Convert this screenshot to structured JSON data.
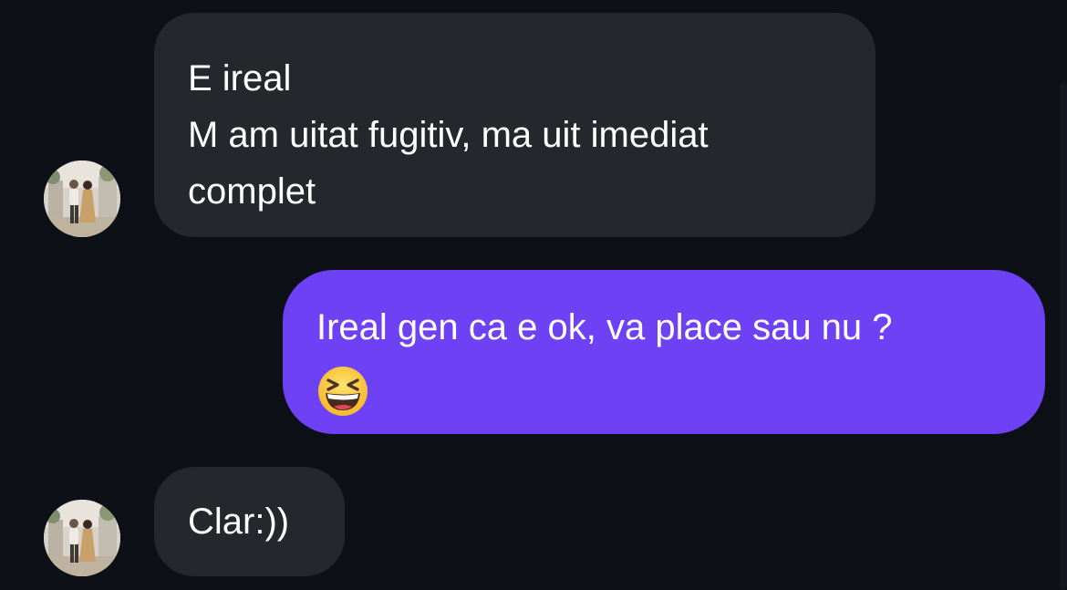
{
  "messages": [
    {
      "direction": "incoming",
      "lines": [
        "E ireal",
        "M am uitat fugitiv, ma uit imediat",
        "complet"
      ],
      "has_avatar": true
    },
    {
      "direction": "outgoing",
      "lines": [
        "Ireal gen ca e ok, va place sau nu ?"
      ],
      "emoji": "grinning-squinting-face"
    },
    {
      "direction": "incoming",
      "lines": [
        "Clar:))"
      ],
      "has_avatar": true
    }
  ],
  "colors": {
    "background": "#0d1017",
    "incoming_bubble": "#25272c",
    "outgoing_bubble": "#6f41f5",
    "text": "#ffffff"
  }
}
